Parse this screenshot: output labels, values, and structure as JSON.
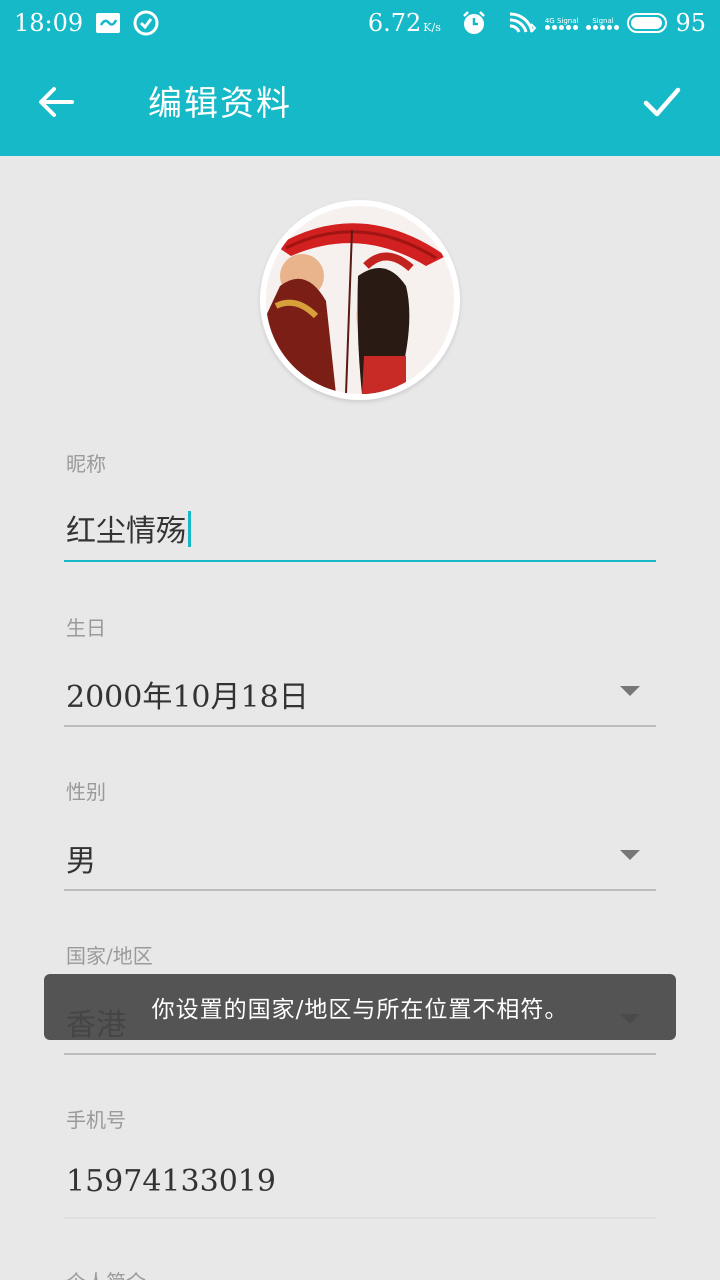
{
  "status_bar": {
    "time": "18:09",
    "speed": "6.72",
    "speed_unit": "K/s",
    "signal_1_label": "4G Signal",
    "signal_2_label": "Signal",
    "battery": "95"
  },
  "toolbar": {
    "title": "编辑资料",
    "back_icon": "arrow-back-icon",
    "confirm_icon": "check-icon"
  },
  "avatar": {
    "icon": "profile-avatar"
  },
  "fields": {
    "nickname": {
      "label": "昵称",
      "value": "红尘情殇"
    },
    "birthday": {
      "label": "生日",
      "value": "2000年10月18日"
    },
    "gender": {
      "label": "性别",
      "value": "男"
    },
    "region": {
      "label": "国家/地区",
      "value": "香港"
    },
    "phone": {
      "label": "手机号",
      "value": "15974133019"
    },
    "bio": {
      "label": "个人简介"
    }
  },
  "toast": {
    "message": "你设置的国家/地区与所在位置不相符。"
  },
  "colors": {
    "accent": "#15b9c8",
    "background": "#e8e8e8",
    "divider": "#bdbdbd"
  }
}
